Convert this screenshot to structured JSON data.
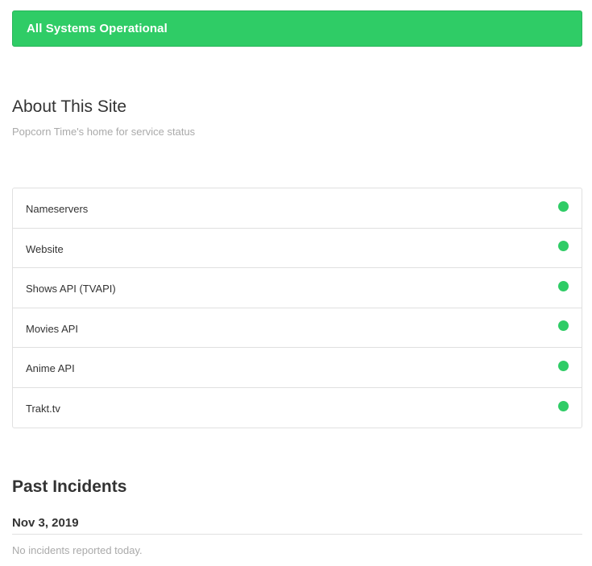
{
  "banner": {
    "text": "All Systems Operational",
    "color": "#2fcc66"
  },
  "about": {
    "title": "About This Site",
    "description": "Popcorn Time's home for service status"
  },
  "components": [
    {
      "name": "Nameservers",
      "status_icon": "green-dot-icon"
    },
    {
      "name": "Website",
      "status_icon": "green-dot-icon"
    },
    {
      "name": "Shows API (TVAPI)",
      "status_icon": "green-dot-icon"
    },
    {
      "name": "Movies API",
      "status_icon": "green-dot-icon"
    },
    {
      "name": "Anime API",
      "status_icon": "green-dot-icon"
    },
    {
      "name": "Trakt.tv",
      "status_icon": "green-dot-icon"
    }
  ],
  "incidents": {
    "title": "Past Incidents",
    "days": [
      {
        "date": "Nov 3, 2019",
        "message": "No incidents reported today."
      }
    ]
  }
}
